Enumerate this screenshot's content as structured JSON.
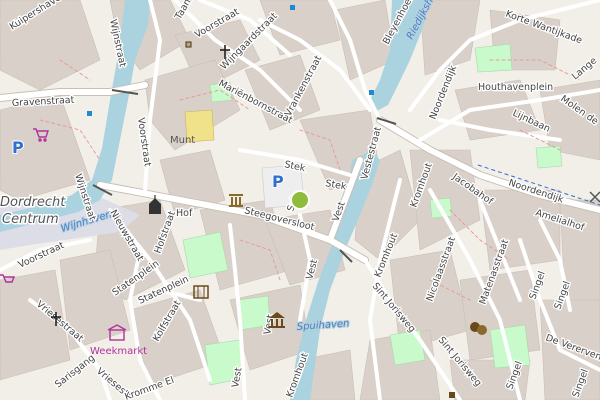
{
  "map": {
    "district": "Dordrecht Centrum",
    "district_line1": "Dordrecht",
    "district_line2": "Centrum",
    "water": {
      "wijnhaven": "Wijnhaven",
      "spuihaven": "Spuihaven",
      "riedijkshaven": "Riedijkshaven"
    },
    "streets": {
      "kuipershaven": "Kuipershaven",
      "wijnstraat_top": "Wijnstraat",
      "wijnstraat_left": "Wijnstraat",
      "taanstraat": "Taanstraat",
      "voorstraat_top": "Voorstraat",
      "voorstraat_mid": "Voorstraat",
      "voorstraat_left": "Voorstraat",
      "wijngaardstraat": "Wijngaardstraat",
      "mariënbornstraat": "Mariënbornstraat",
      "vrankenstraat": "Vrankenstraat",
      "gravenstraat": "Gravenstraat",
      "stek": "Stek",
      "stek2": "Stek",
      "steegoversloot": "Steegoversloot",
      "sch": "Sch",
      "vest_a": "Vest",
      "vest_b": "Vest",
      "vest_c": "Vest",
      "vest_d": "Vest",
      "vest_e": "Vest",
      "hof": "Hof",
      "hofstraat": "Hofstraat",
      "nieuwstraat": "Nieuwstraat",
      "statenplein_a": "Statenplein",
      "statenplein_b": "Statenplein",
      "vriesestraat": "Vriesestraat",
      "vriesestr_b": "Vriesestr",
      "kolfstraat": "Kolfstraat",
      "sarisgang": "Sarisgang",
      "kromme_el": "Kromme El",
      "kromhout_a": "Kromhout",
      "kromhout_b": "Kromhout",
      "kromhout_c": "Kromhout",
      "sint_jorisweg_a": "Sint Jorisweg",
      "sint_jorisweg_b": "Sint Jorisweg",
      "nicolaasstraat": "Nicolaasstraat",
      "matenastraat": "Matenasstraat",
      "singel_a": "Singel",
      "singel_b": "Singel",
      "singel_c": "Singel",
      "singel_d": "Singel",
      "de_vererven": "De Vererven",
      "noordendijk": "Noordendijk",
      "amelialhof": "Amelialhof",
      "jacobahof": "Jacobahof",
      "lijnbaan": "Lijnbaan",
      "houthavenplein": "Houthavenplein",
      "noordendijk_str": "Noordendijk",
      "korte_wantijkade": "Korte Wantijkade",
      "lange": "Lange",
      "molen_de": "Molen de",
      "bleyenhoek": "Bleyenhoek",
      "mont": "Munt",
      "vestsstraat": "Vestestraat"
    },
    "pois": {
      "weekmarkt": "Weekmarkt",
      "parking_left": "P",
      "parking_center": "P"
    },
    "icons": [
      "church-icon",
      "courthouse-icon",
      "parking-icon",
      "shopping-cart-icon",
      "cinema-icon",
      "museum-icon",
      "theatre-icon",
      "market-icon",
      "location-marker-icon",
      "bus-stop-icon",
      "windmill-icon"
    ],
    "colors": {
      "background": "#f2efe9",
      "building": "#d9d0c9",
      "water": "#aad3df",
      "road": "#ffffff",
      "park": "#c8facc",
      "pedestrian": "#dddde8",
      "railway": "#999999",
      "marker": "#8fbc3a",
      "poi": "#b0329b",
      "parking": "#2e6fd1"
    }
  }
}
